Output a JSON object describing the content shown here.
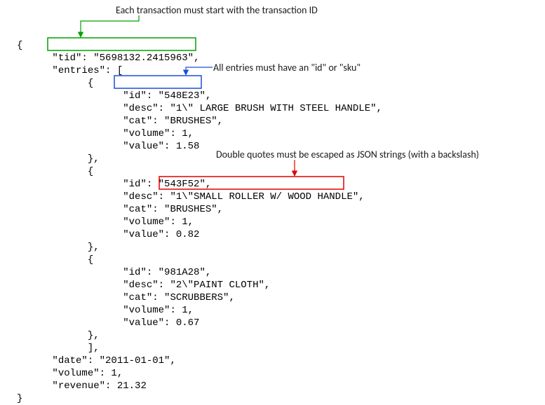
{
  "annotations": {
    "tid_note": "Each transaction must start with the transaction ID",
    "id_note_part1": "All entries must have an \"id\" or \"sku\"",
    "desc_note": "Double quotes must be escaped as JSON strings (with a backslash)"
  },
  "code": {
    "open": "{",
    "tid_key": "\"tid\":",
    "tid_val": " \"5698132.2415963\",",
    "entries_key": "\"entries\": [",
    "entry_open": "{",
    "e1_id_key": "\"id\":",
    "e1_id_val": " \"548E23\",",
    "e1_desc": "\"desc\": \"1\\\" LARGE BRUSH WITH STEEL HANDLE\",",
    "e1_cat": "\"cat\": \"BRUSHES\",",
    "e1_vol": "\"volume\": 1,",
    "e1_val": "\"value\": 1.58",
    "entry_close_comma": "},",
    "e2_id": "\"id\": \"543F52\",",
    "e2_desc_key": "\"desc\":",
    "e2_desc_val": " \"1\\\"SMALL ROLLER W/ WOOD HANDLE\",",
    "e2_cat": "\"cat\": \"BRUSHES\",",
    "e2_vol": "\"volume\": 1,",
    "e2_val": "\"value\": 0.82",
    "e3_id": "\"id\": \"981A28\",",
    "e3_desc": "\"desc\": \"2\\\"PAINT CLOTH\",",
    "e3_cat": "\"cat\": \"SCRUBBERS\",",
    "e3_vol": "\"volume\": 1,",
    "e3_val": "\"value\": 0.67",
    "entries_close": "],",
    "date": "\"date\": \"2011-01-01\",",
    "volume": "\"volume\": 1,",
    "revenue": "\"revenue\": 21.32",
    "close": "}"
  },
  "colors": {
    "tid_box": "#00a000",
    "id_box": "#1a4fd6",
    "desc_box": "#e00000"
  }
}
